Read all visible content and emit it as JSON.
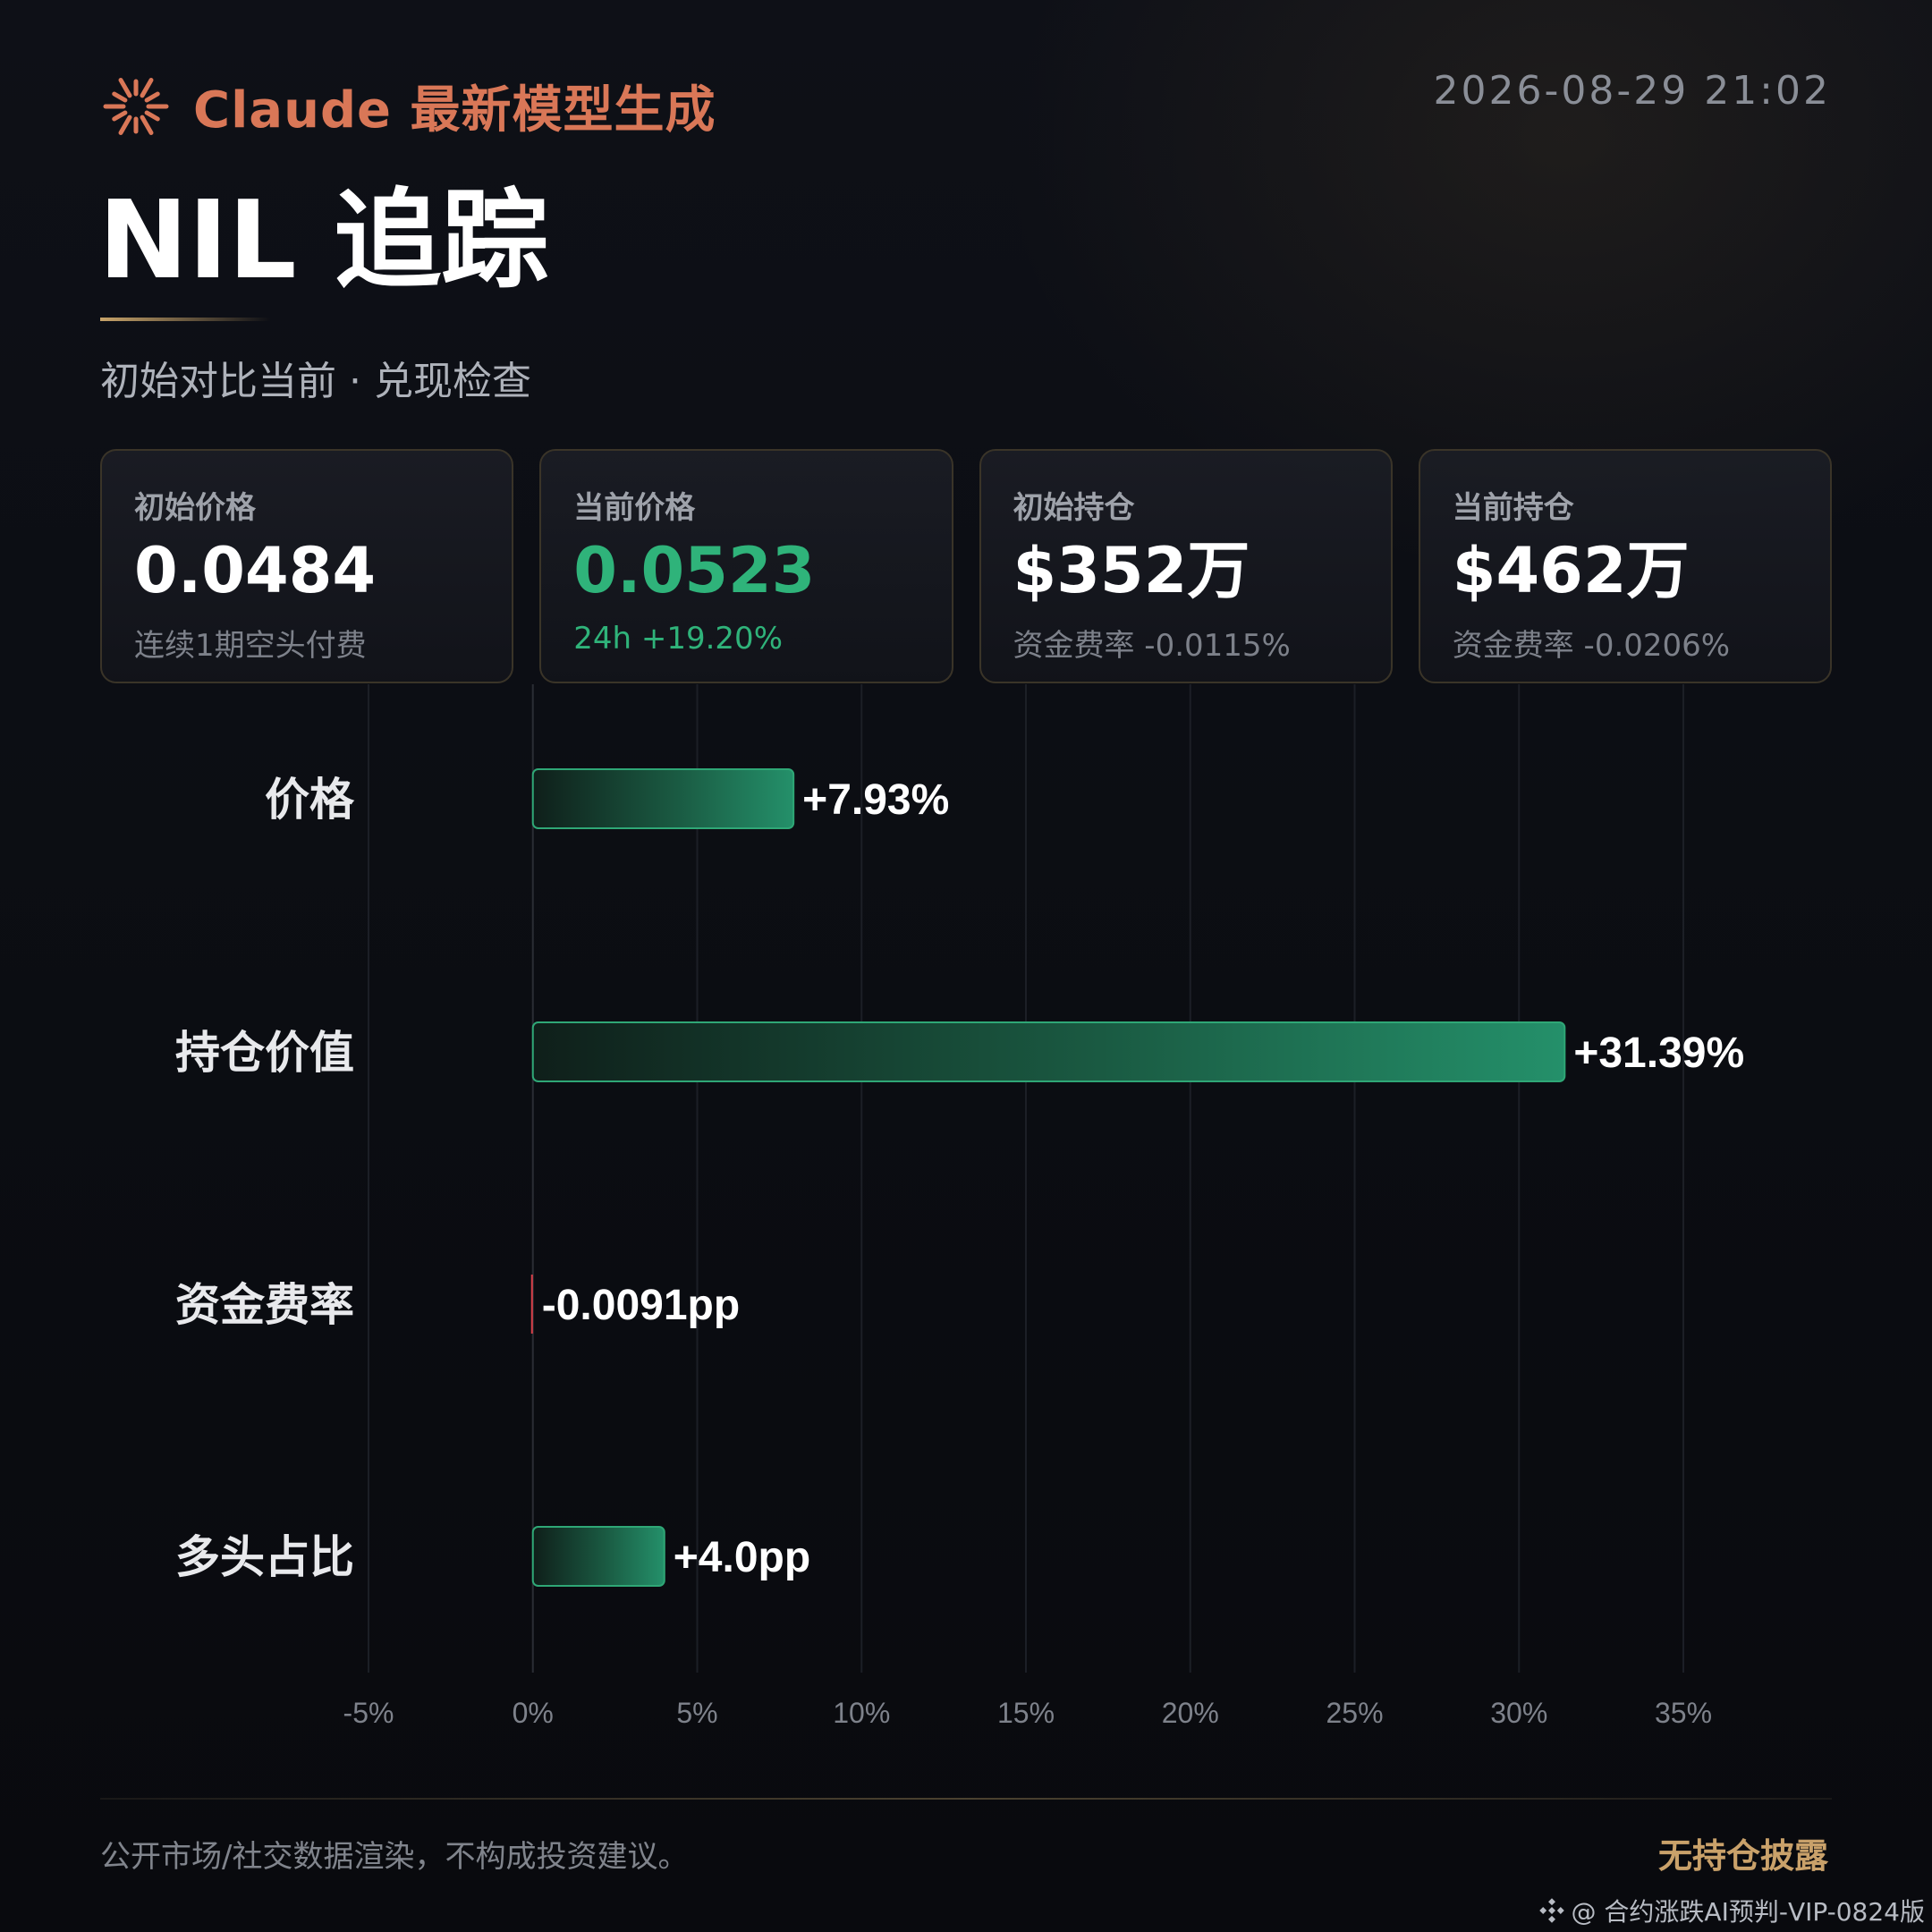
{
  "header": {
    "brand": "Claude 最新模型生成",
    "timestamp": "2026-08-29 21:02",
    "title": "NIL 追踪",
    "subtitle": "初始对比当前 · 兑现检查"
  },
  "cards": [
    {
      "label": "初始价格",
      "value": "0.0484",
      "sub": "连续1期空头付费",
      "accent": ""
    },
    {
      "label": "当前价格",
      "value": "0.0523",
      "sub": "24h +19.20%",
      "accent": "green"
    },
    {
      "label": "初始持仓",
      "value": "$352万",
      "sub": "资金费率 -0.0115%",
      "accent": ""
    },
    {
      "label": "当前持仓",
      "value": "$462万",
      "sub": "资金费率 -0.0206%",
      "accent": ""
    }
  ],
  "chart_data": {
    "type": "bar",
    "orientation": "horizontal",
    "categories": [
      "价格",
      "持仓价值",
      "资金费率",
      "多头占比"
    ],
    "values": [
      7.93,
      31.39,
      -0.0091,
      4.0
    ],
    "value_labels": [
      "+7.93%",
      "+31.39%",
      "-0.0091pp",
      "+4.0pp"
    ],
    "xlim": [
      -5,
      35
    ],
    "xticks": [
      -5,
      0,
      5,
      10,
      15,
      20,
      25,
      30,
      35
    ],
    "xtick_labels": [
      "-5%",
      "0%",
      "5%",
      "10%",
      "15%",
      "20%",
      "25%",
      "30%",
      "35%"
    ],
    "grid": true,
    "colors": {
      "positive": "#2a9a6a",
      "negative": "#d9404a"
    }
  },
  "footer": {
    "disclaimer": "公开市场/社交数据渲染，不构成投资建议。",
    "badge": "无持仓披露"
  },
  "watermark": "@ 合约涨跌AI预判-VIP-0824版",
  "colors": {
    "brand": "#d97757",
    "gold": "#c9a16a",
    "green": "#2fb37a",
    "background": "#0b0d12"
  }
}
